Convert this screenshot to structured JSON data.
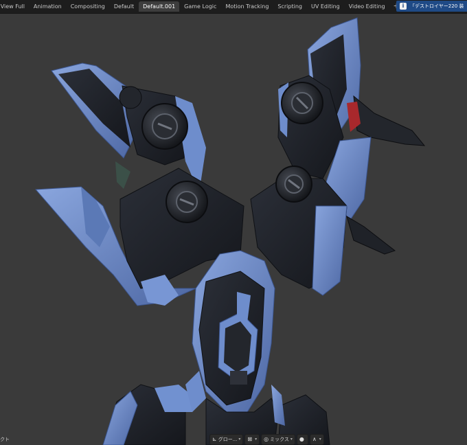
{
  "workspace_tabs": [
    {
      "label": "D View Full",
      "active": false
    },
    {
      "label": "Animation",
      "active": false
    },
    {
      "label": "Compositing",
      "active": false
    },
    {
      "label": "Default",
      "active": false
    },
    {
      "label": "Default.001",
      "active": true
    },
    {
      "label": "Game Logic",
      "active": false
    },
    {
      "label": "Motion Tracking",
      "active": false
    },
    {
      "label": "Scripting",
      "active": false
    },
    {
      "label": "UV Editing",
      "active": false
    },
    {
      "label": "Video Editing",
      "active": false
    }
  ],
  "add_tab_glyph": "+",
  "info_banner": {
    "icon": "info-icon",
    "icon_glyph": "i",
    "text": "「デストロイヤー220 装"
  },
  "bottom_left_text": "クト",
  "header_tools": {
    "transform_orientation": {
      "icon": "transform-orientation-icon",
      "icon_glyph": "⊾",
      "label": "グロー..."
    },
    "pivot": {
      "icon": "pivot-icon",
      "icon_glyph": "⊠"
    },
    "shading_mix": {
      "icon": "mix-icon",
      "icon_glyph": "◎",
      "label": "ミックス"
    },
    "snap": {
      "icon": "snap-icon",
      "icon_glyph": "●"
    },
    "proportional": {
      "icon": "proportional-icon",
      "icon_glyph": "∧"
    }
  },
  "colors": {
    "topbar_bg": "#1d1d1d",
    "viewport_bg": "#3a3a3a",
    "active_tab": "#3d3d3d",
    "info_banner": "#1f4a86",
    "armor_blue": "#6f8fcf",
    "armor_dark": "#1c1f26"
  }
}
